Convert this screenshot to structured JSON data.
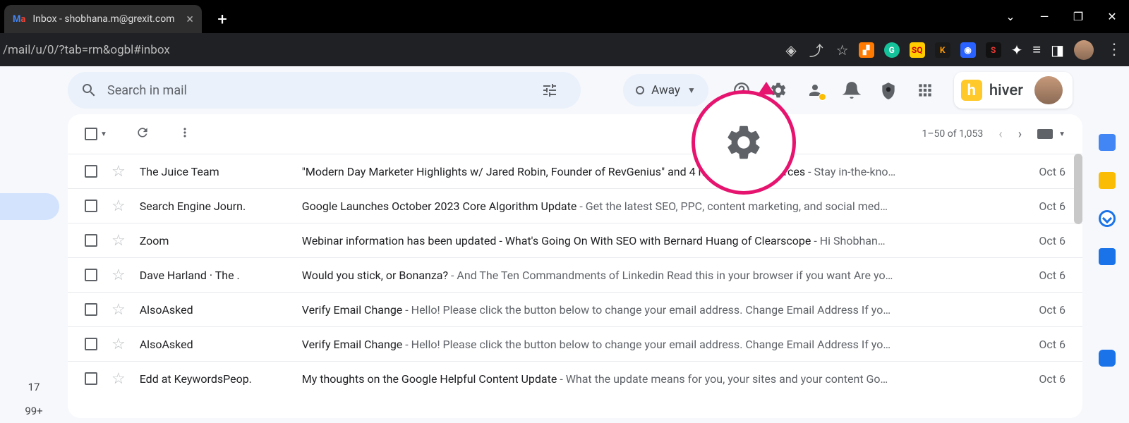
{
  "browser": {
    "tab_title": "Inbox - shobhana.m@grexit.com",
    "url": "/mail/u/0/?tab=rm&ogbl#inbox"
  },
  "search": {
    "placeholder": "Search in mail"
  },
  "status": {
    "label": "Away"
  },
  "hiver": {
    "label": "hiver"
  },
  "toolbar": {
    "page_info": "1–50 of 1,053"
  },
  "leftnav": {
    "count_a": "17",
    "count_b": "99+"
  },
  "emails": [
    {
      "sender": "The Juice Team",
      "subject": "\"Modern Day Marketer Highlights w/ Jared Robin, Founder of RevGenius\" and 4 more fresh resources",
      "preview": "Stay in-the-kno…",
      "date": "Oct 6"
    },
    {
      "sender": "Search Engine Journ.",
      "subject": "Google Launches October 2023 Core Algorithm Update",
      "preview": "Get the latest SEO, PPC, content marketing, and social med…",
      "date": "Oct 6"
    },
    {
      "sender": "Zoom",
      "subject": "Webinar information has been updated - What's Going On With SEO with Bernard Huang of Clearscope",
      "preview": "Hi Shobhan…",
      "date": "Oct 6"
    },
    {
      "sender": "Dave Harland · The .",
      "subject": "Would you stick, or Bonanza?",
      "preview": "And The Ten Commandments of Linkedin Read this in your browser if you want Are yo…",
      "date": "Oct 6"
    },
    {
      "sender": "AlsoAsked",
      "subject": "Verify Email Change",
      "preview": "Hello! Please click the button below to change your email address. Change Email Address If yo…",
      "date": "Oct 6"
    },
    {
      "sender": "AlsoAsked",
      "subject": "Verify Email Change",
      "preview": "Hello! Please click the button below to change your email address. Change Email Address If yo…",
      "date": "Oct 6"
    },
    {
      "sender": "Edd at KeywordsPeop.",
      "subject": "My thoughts on the Google Helpful Content Update",
      "preview": "What the update means for you, your sites and your content Go…",
      "date": "Oct 6"
    }
  ]
}
